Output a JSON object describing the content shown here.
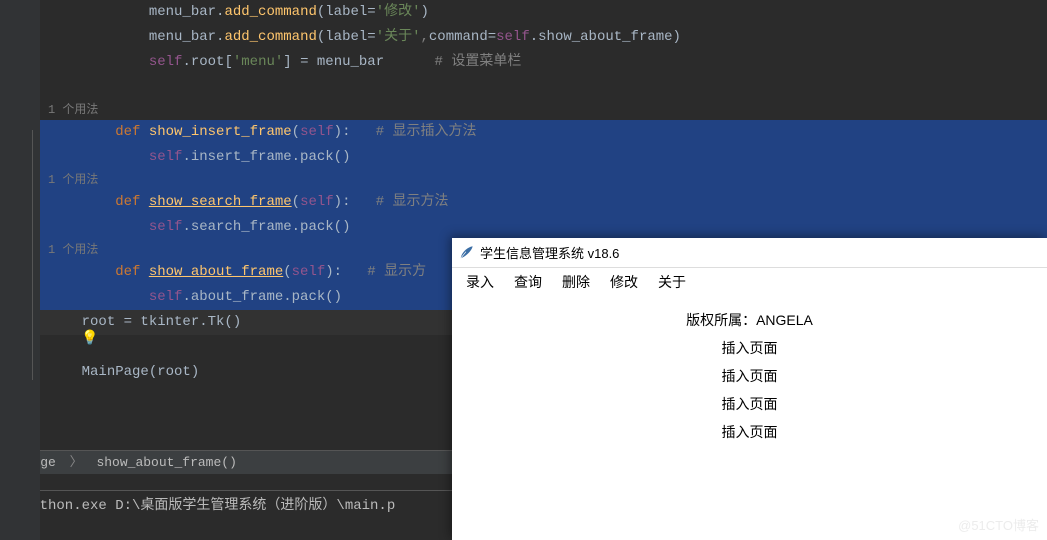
{
  "code": {
    "l1_a": "menu_bar.",
    "l1_b": "add_command",
    "l1_c": "(label=",
    "l1_d": "'修改'",
    "l1_e": ")",
    "l2_a": "menu_bar.",
    "l2_b": "add_command",
    "l2_c": "(label=",
    "l2_d": "'关于'",
    "l2_e": ",",
    "l2_f": "command",
    "l2_g": "=",
    "l2_h": "self",
    "l2_i": ".show_about_frame)",
    "l3_a": "self",
    "l3_b": ".root[",
    "l3_c": "'menu'",
    "l3_d": "] = menu_bar      ",
    "l3_e": "# 设置菜单栏",
    "hint": "1 个用法",
    "l4_a": "def ",
    "l4_b": "show_insert_frame",
    "l4_c": "(",
    "l4_d": "self",
    "l4_e": "):   ",
    "l4_f": "# 显示插入方法",
    "l5_a": "self",
    "l5_b": ".insert_frame.pack()",
    "l6_a": "def ",
    "l6_b": "show_search_frame",
    "l6_c": "(",
    "l6_d": "self",
    "l6_e": "):   ",
    "l6_f": "# 显示方法",
    "l7_a": "self",
    "l7_b": ".search_frame.pack()",
    "l8_a": "def ",
    "l8_b": "show_about_frame",
    "l8_c": "(",
    "l8_d": "self",
    "l8_e": "):   ",
    "l8_f": "# 显示方",
    "l9_a": "self",
    "l9_b": ".about_frame.pack()",
    "l10_a": "root = tkinter.Tk()",
    "l11_a": "MainPage(root)"
  },
  "breadcrumb": {
    "a": "inPage",
    "b": "show_about_frame()"
  },
  "console": {
    "line": "s\\python.exe D:\\桌面版学生管理系统（进阶版）\\main.p"
  },
  "app": {
    "title": "学生信息管理系统 v18.6",
    "menus": [
      "录入",
      "查询",
      "删除",
      "修改",
      "关于"
    ],
    "body": {
      "copyright": "版权所属：ANGELA",
      "rows": [
        "插入页面",
        "插入页面",
        "插入页面",
        "插入页面"
      ]
    }
  },
  "watermark": "@51CTO博客"
}
